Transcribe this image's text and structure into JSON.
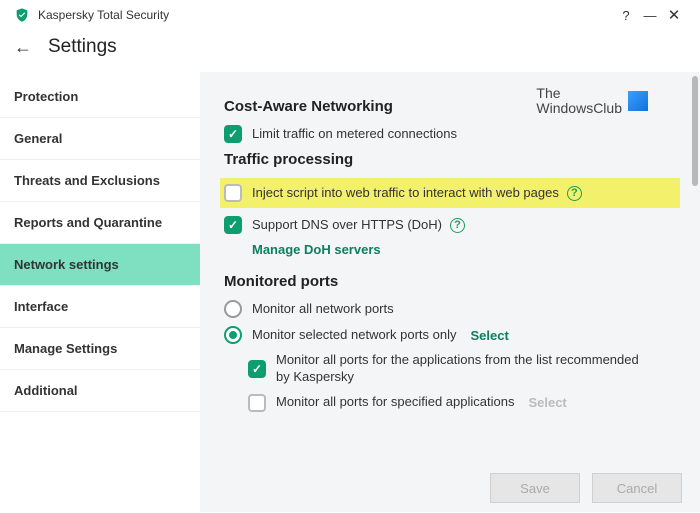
{
  "titlebar": {
    "app_name": "Kaspersky Total Security"
  },
  "header": {
    "page_title": "Settings"
  },
  "sidebar": {
    "items": [
      {
        "label": "Protection"
      },
      {
        "label": "General"
      },
      {
        "label": "Threats and Exclusions"
      },
      {
        "label": "Reports and Quarantine"
      },
      {
        "label": "Network settings"
      },
      {
        "label": "Interface"
      },
      {
        "label": "Manage Settings"
      },
      {
        "label": "Additional"
      }
    ]
  },
  "content": {
    "section1_title": "Cost-Aware Networking",
    "limit_traffic_label": "Limit traffic on metered connections",
    "section2_title": "Traffic processing",
    "inject_script_label": "Inject script into web traffic to interact with web pages",
    "dns_doh_label": "Support DNS over HTTPS (DoH)",
    "manage_doh_link": "Manage DoH servers",
    "section3_title": "Monitored ports",
    "monitor_all_label": "Monitor all network ports",
    "monitor_selected_label": "Monitor selected network ports only",
    "select_link": "Select",
    "monitor_recommended_label": "Monitor all ports for the applications from the list recommended by Kaspersky",
    "monitor_specified_label": "Monitor all ports for specified applications",
    "select2_link": "Select"
  },
  "footer": {
    "save": "Save",
    "cancel": "Cancel"
  },
  "watermark": {
    "line1": "The",
    "line2": "WindowsClub"
  }
}
